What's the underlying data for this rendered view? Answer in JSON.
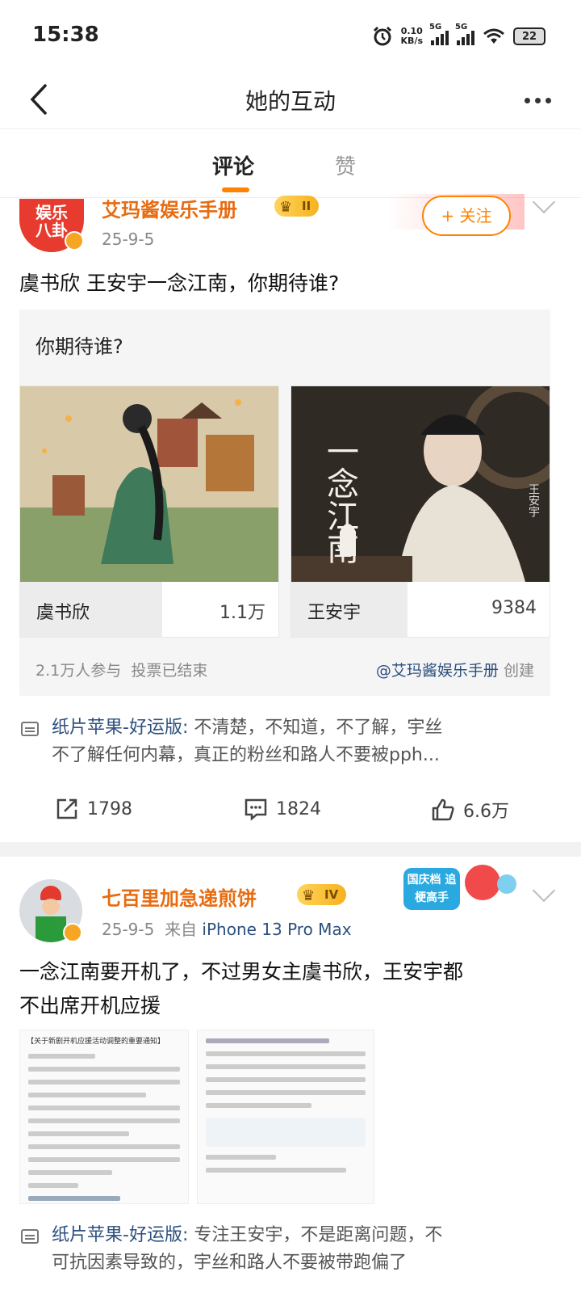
{
  "status": {
    "time": "15:38",
    "speed": "0.10",
    "speed_unit": "KB/s",
    "net1": "5G",
    "net2": "5G",
    "battery": "22"
  },
  "header": {
    "title": "她的互动"
  },
  "tabs": [
    {
      "label": "评论"
    },
    {
      "label": "赞"
    }
  ],
  "post1": {
    "username": "艾玛酱娱乐手册",
    "vip_level": "II",
    "avatar_text": "娱乐八卦",
    "date": "25-9-5",
    "follow_label": "+ 关注",
    "text": "虞书欣 王安宇一念江南，你期待谁?",
    "vote": {
      "question": "你期待谁?",
      "options": [
        {
          "name": "虞书欣",
          "count": "1.1万",
          "share": 0.55
        },
        {
          "name": "王安宇",
          "count": "9384",
          "share": 0.45
        }
      ],
      "participants": "2.1万人参与",
      "status": "投票已结束",
      "creator": "@艾玛酱娱乐手册",
      "creator_suffix": "创建",
      "poster_title": "一念江南",
      "poster_actor": "王安宇"
    },
    "comment": {
      "author": "纸片苹果-好运版:",
      "text_line1": "不清楚，不知道，不了解，宇丝",
      "text_line2": "不了解任何内幕，真正的粉丝和路人不要被pph..."
    },
    "actions": {
      "share": "1798",
      "comment": "1824",
      "like": "6.6万"
    }
  },
  "post2": {
    "username": "七百里加急递煎饼",
    "vip_level": "IV",
    "date": "25-9-5",
    "source_prefix": "来自",
    "source": "iPhone 13 Pro Max",
    "badge": "国庆档 追梗高手",
    "text_line1": "一念江南要开机了，不过男女主虞书欣，王安宇都",
    "text_line2": "不出席开机应援",
    "doc1_title": "【关于新剧开机应援活动调整的重要通知】",
    "comment": {
      "author": "纸片苹果-好运版:",
      "text_line1": "专注王安宇，不是距离问题，不",
      "text_line2": "可抗因素导致的，宇丝和路人不要被带跑偏了"
    }
  }
}
